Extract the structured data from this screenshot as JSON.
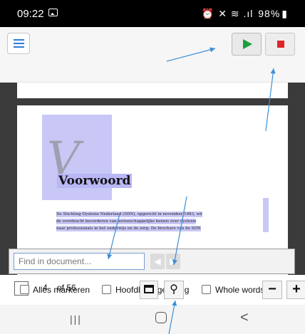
{
  "status": {
    "time": "09:22",
    "icons_right": "⏰ ✕ ≋ .ıl",
    "battery": "98%"
  },
  "toolbar": {
    "menu_icon": "hamburger-icon",
    "play_icon": "play-icon",
    "stop_icon": "stop-icon"
  },
  "document": {
    "title": "Voorwoord",
    "para_lines": [
      "De Stichting Dyslexie Nederland (SDN), opgericht in november 1983, wil",
      "de overdracht bevorderen van wetenschappelijke kennis over dyslexie",
      "naar professionals in het onderwijs en de zorg. De brochure van de SDN"
    ]
  },
  "find": {
    "placeholder": "Find in document...",
    "prev": "◀",
    "next": "▶"
  },
  "options": {
    "page_current": "4",
    "page_total": "of 56",
    "highlight_all": "Alles markeren",
    "match_case": "Hoofdlettergevoelig",
    "whole_words": "Whole words",
    "zoom_minus": "−",
    "zoom_plus": "+"
  },
  "nav": {
    "recents": "|||",
    "back": "<"
  }
}
